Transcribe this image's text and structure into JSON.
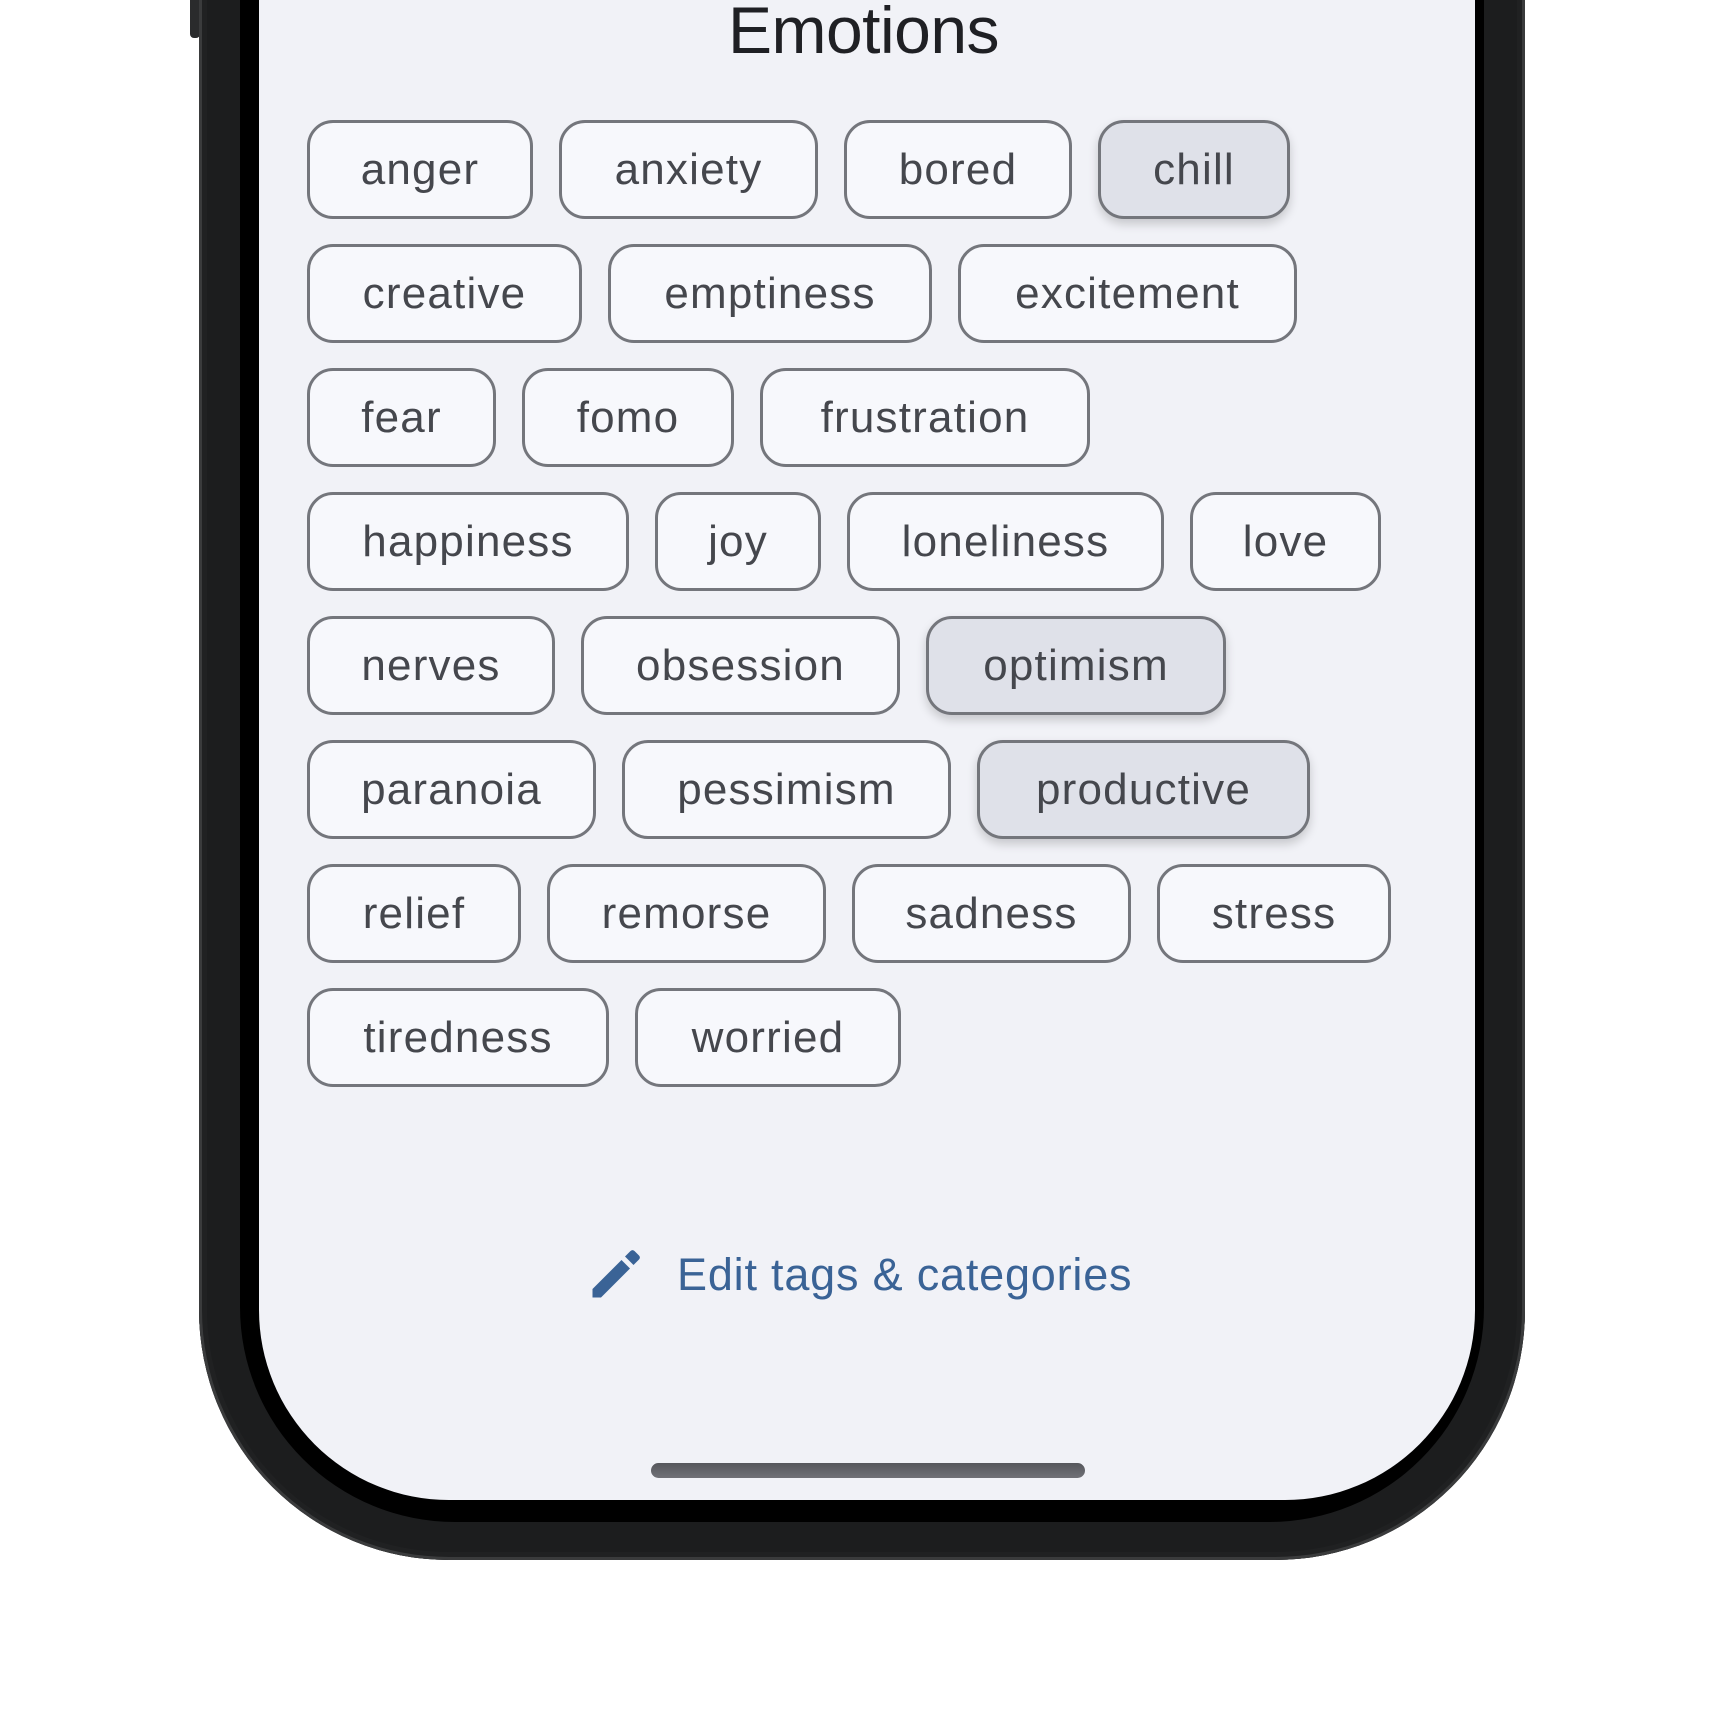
{
  "screen": {
    "title": "Emotions",
    "tags": [
      {
        "label": "anger",
        "selected": false
      },
      {
        "label": "anxiety",
        "selected": false
      },
      {
        "label": "bored",
        "selected": false
      },
      {
        "label": "chill",
        "selected": true
      },
      {
        "label": "creative",
        "selected": false
      },
      {
        "label": "emptiness",
        "selected": false
      },
      {
        "label": "excitement",
        "selected": false
      },
      {
        "label": "fear",
        "selected": false
      },
      {
        "label": "fomo",
        "selected": false
      },
      {
        "label": "frustration",
        "selected": false
      },
      {
        "label": "happiness",
        "selected": false
      },
      {
        "label": "joy",
        "selected": false
      },
      {
        "label": "loneliness",
        "selected": false
      },
      {
        "label": "love",
        "selected": false
      },
      {
        "label": "nerves",
        "selected": false
      },
      {
        "label": "obsession",
        "selected": false
      },
      {
        "label": "optimism",
        "selected": true
      },
      {
        "label": "paranoia",
        "selected": false
      },
      {
        "label": "pessimism",
        "selected": false
      },
      {
        "label": "productive",
        "selected": true
      },
      {
        "label": "relief",
        "selected": false
      },
      {
        "label": "remorse",
        "selected": false
      },
      {
        "label": "sadness",
        "selected": false
      },
      {
        "label": "stress",
        "selected": false
      },
      {
        "label": "tiredness",
        "selected": false
      },
      {
        "label": "worried",
        "selected": false
      }
    ],
    "edit_link": {
      "label": "Edit tags & categories",
      "icon": "pencil-icon"
    },
    "colors": {
      "accent": "#3a6396",
      "chip_selected_bg": "#dfe1e9",
      "chip_bg": "#f7f8fc",
      "background": "#f1f2f7"
    }
  }
}
